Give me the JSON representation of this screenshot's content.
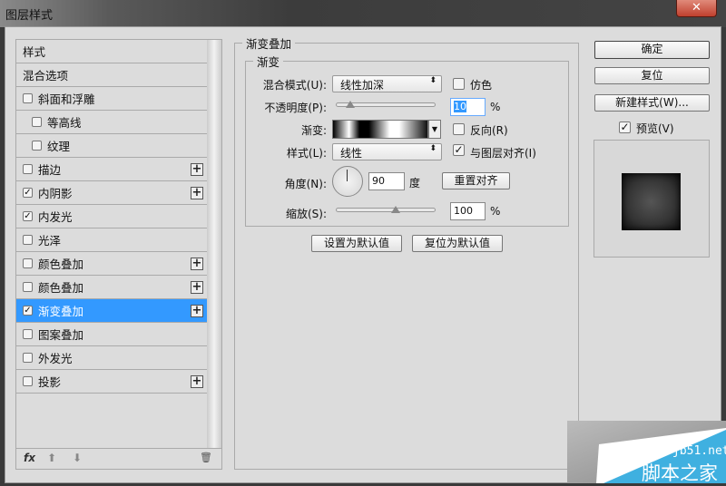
{
  "window": {
    "title": "图层样式",
    "close": "✕"
  },
  "styles_list": {
    "items": [
      {
        "label": "样式",
        "checkbox": false,
        "indent": 0,
        "plus": false
      },
      {
        "label": "混合选项",
        "checkbox": false,
        "indent": 0,
        "plus": false
      },
      {
        "label": "斜面和浮雕",
        "checkbox": true,
        "checked": false,
        "indent": 0,
        "plus": false
      },
      {
        "label": "等高线",
        "checkbox": true,
        "checked": false,
        "indent": 1,
        "plus": false
      },
      {
        "label": "纹理",
        "checkbox": true,
        "checked": false,
        "indent": 1,
        "plus": false
      },
      {
        "label": "描边",
        "checkbox": true,
        "checked": false,
        "indent": 0,
        "plus": true
      },
      {
        "label": "内阴影",
        "checkbox": true,
        "checked": true,
        "indent": 0,
        "plus": true
      },
      {
        "label": "内发光",
        "checkbox": true,
        "checked": true,
        "indent": 0,
        "plus": false
      },
      {
        "label": "光泽",
        "checkbox": true,
        "checked": false,
        "indent": 0,
        "plus": false
      },
      {
        "label": "颜色叠加",
        "checkbox": true,
        "checked": false,
        "indent": 0,
        "plus": true
      },
      {
        "label": "颜色叠加",
        "checkbox": true,
        "checked": false,
        "indent": 0,
        "plus": true
      },
      {
        "label": "渐变叠加",
        "checkbox": true,
        "checked": true,
        "indent": 0,
        "plus": true,
        "selected": true
      },
      {
        "label": "图案叠加",
        "checkbox": true,
        "checked": false,
        "indent": 0,
        "plus": false
      },
      {
        "label": "外发光",
        "checkbox": true,
        "checked": false,
        "indent": 0,
        "plus": false
      },
      {
        "label": "投影",
        "checkbox": true,
        "checked": false,
        "indent": 0,
        "plus": true
      }
    ],
    "footer": {
      "fx": "fx",
      "up": "⬆",
      "down": "⬇",
      "trash": "🗑"
    }
  },
  "panel": {
    "title": "渐变叠加",
    "group": "渐变",
    "blend_mode_label": "混合模式(U):",
    "blend_mode": "线性加深",
    "dither_label": "仿色",
    "opacity_label": "不透明度(P):",
    "opacity": "10",
    "opacity_fraction": 0.1,
    "percent": "%",
    "gradient_label": "渐变:",
    "reverse_label": "反向(R)",
    "style_label": "样式(L):",
    "style": "线性",
    "align_label": "与图层对齐(I)",
    "angle_label": "角度(N):",
    "angle": "90",
    "degree": "度",
    "reset_align": "重置对齐",
    "scale_label": "缩放(S):",
    "scale": "100",
    "scale_fraction": 0.5,
    "make_default": "设置为默认值",
    "reset_default": "复位为默认值"
  },
  "actions": {
    "ok": "确定",
    "reset": "复位",
    "new_style": "新建样式(W)...",
    "preview_label": "预览(V)"
  },
  "watermark": {
    "site": "jb51.net",
    "name": "脚本之家"
  }
}
